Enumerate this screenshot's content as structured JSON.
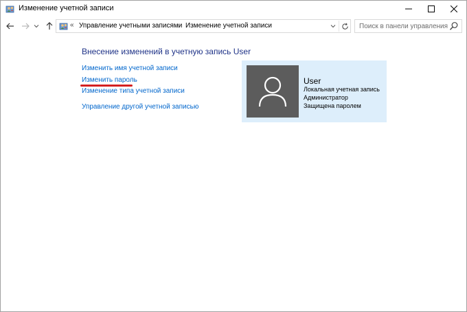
{
  "window": {
    "title": "Изменение учетной записи"
  },
  "address_bar": {
    "overflow_chevron": "«",
    "crumbs": [
      "Управление учетными записями",
      "Изменение учетной записи"
    ],
    "separator": "›"
  },
  "search": {
    "placeholder": "Поиск в панели управления"
  },
  "main": {
    "heading": "Внесение изменений в учетную запись User",
    "tasks": [
      "Изменить имя учетной записи",
      "Изменить пароль",
      "Изменение типа учетной записи",
      "Управление другой учетной записью"
    ],
    "highlight_color": "#d42020"
  },
  "account": {
    "name": "User",
    "details": [
      "Локальная учетная запись",
      "Администратор",
      "Защищена паролем"
    ]
  },
  "colors": {
    "link": "#0066cc",
    "heading": "#1e3287",
    "card_bg": "#ddeefb",
    "avatar_bg": "#5c5c5c"
  },
  "icons": {
    "title": "control-panel-users-icon",
    "address": "control-panel-users-icon",
    "back": "arrow-left-icon",
    "forward": "arrow-right-icon",
    "up": "arrow-up-icon",
    "refresh": "refresh-icon",
    "search": "search-icon",
    "avatar": "user-silhouette-icon"
  }
}
